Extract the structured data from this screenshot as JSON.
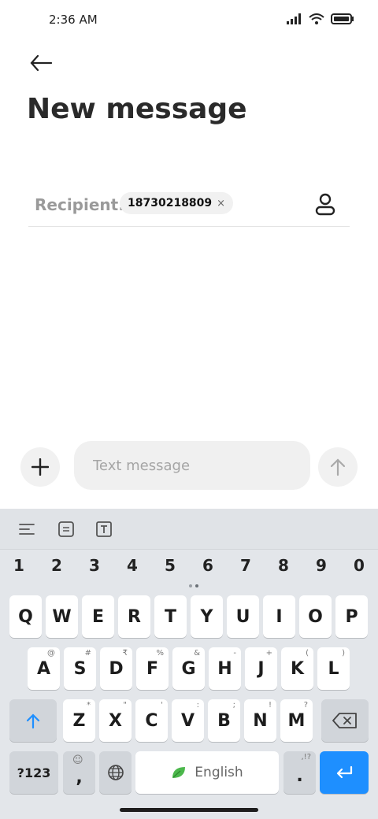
{
  "status": {
    "time": "2:36 AM"
  },
  "header": {
    "title": "New message"
  },
  "recipient": {
    "label": "Recipient:",
    "chip": "18730218809",
    "chip_close": "×"
  },
  "compose": {
    "placeholder": "Text message"
  },
  "keyboard": {
    "numbers": [
      "1",
      "2",
      "3",
      "4",
      "5",
      "6",
      "7",
      "8",
      "9",
      "0"
    ],
    "row1": [
      "Q",
      "W",
      "E",
      "R",
      "T",
      "Y",
      "U",
      "I",
      "O",
      "P"
    ],
    "row2": [
      "A",
      "S",
      "D",
      "F",
      "G",
      "H",
      "J",
      "K",
      "L"
    ],
    "row2_alt": [
      "@",
      "#",
      "₹",
      "%",
      "&",
      "-",
      "+",
      "(",
      ")"
    ],
    "row3": [
      "Z",
      "X",
      "C",
      "V",
      "B",
      "N",
      "M"
    ],
    "row3_alt": [
      "*",
      "\"",
      "'",
      ":",
      ";",
      "!",
      "?"
    ],
    "num_switch": "?123",
    "comma": ",",
    "space_label": "English",
    "period": ".",
    "period_alt": ",!?"
  },
  "colors": {
    "accent": "#1e8fff",
    "keyboard_bg": "#e3e6ea"
  }
}
